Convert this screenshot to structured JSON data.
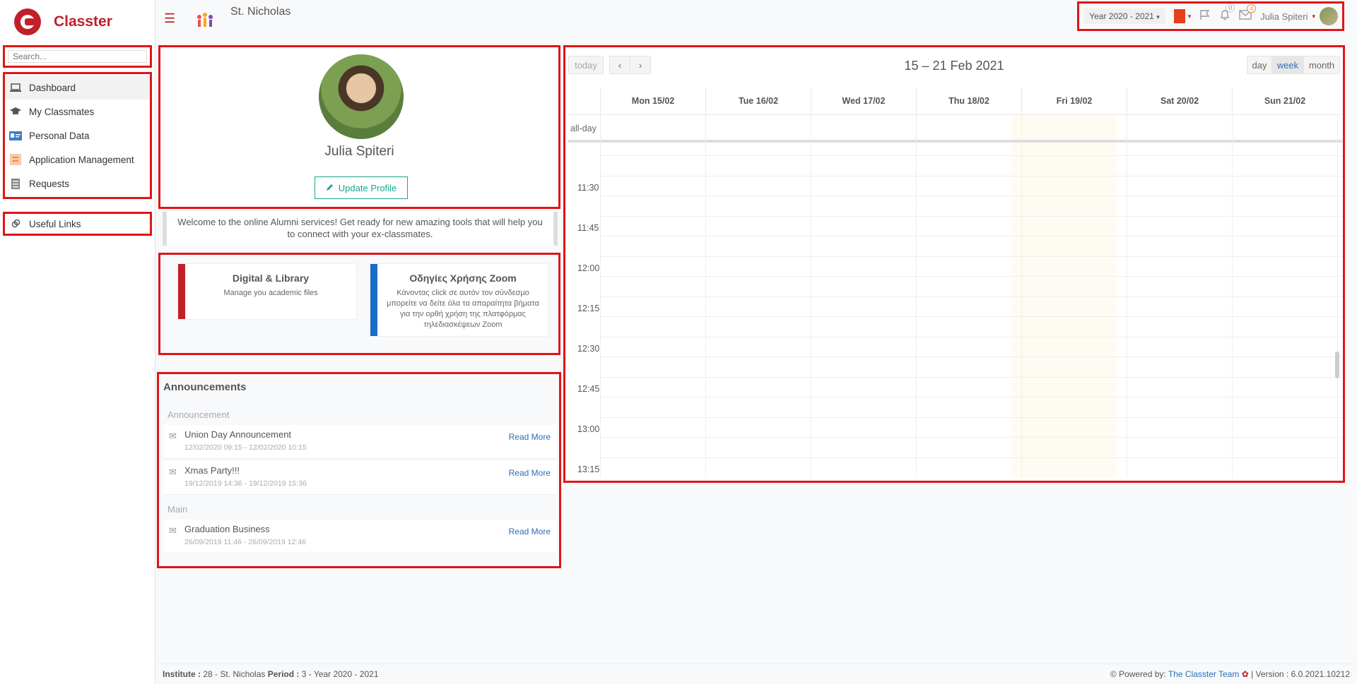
{
  "app": {
    "name": "Classter"
  },
  "sidebar": {
    "search_placeholder": "Search...",
    "items": [
      {
        "label": "Dashboard"
      },
      {
        "label": "My Classmates"
      },
      {
        "label": "Personal Data"
      },
      {
        "label": "Application Management"
      },
      {
        "label": "Requests"
      }
    ],
    "useful_links": "Useful Links"
  },
  "header": {
    "school_name": "St. Nicholas",
    "year": "Year 2020 - 2021",
    "notifications_count": "0",
    "messages_count": "4",
    "user_name": "Julia Spiteri"
  },
  "profile": {
    "name": "Julia Spiteri",
    "update_label": "Update Profile"
  },
  "welcome_text": "Welcome to the online Alumni services! Get ready for new amazing tools that will help you to connect with your ex-classmates.",
  "link_cards": [
    {
      "title": "Digital & Library",
      "desc": "Manage you academic files",
      "color": "#c0202a"
    },
    {
      "title": "Οδηγίες Χρήσης Zoom",
      "desc": "Κάνοντας click σε αυτόν τον σύνδεσμο μπορείτε να δείτε όλα τα απαραίτητα βήματα για την ορθή χρήση της πλατφόρμας τηλεδιασκέψεων Zoom",
      "color": "#1a6cc6"
    }
  ],
  "announcements": {
    "title": "Announcements",
    "groups": [
      {
        "name": "Announcement",
        "items": [
          {
            "title": "Union Day Announcement",
            "date": "12/02/2020 09:15 - 12/02/2020 10:15",
            "action": "Read More"
          },
          {
            "title": "Xmas Party!!!",
            "date": "19/12/2019 14:36 - 19/12/2019 15:36",
            "action": "Read More"
          }
        ]
      },
      {
        "name": "Main",
        "items": [
          {
            "title": "Graduation Business",
            "date": "26/09/2019 11:46 - 26/09/2019 12:46",
            "action": "Read More"
          }
        ]
      }
    ]
  },
  "calendar": {
    "title": "15 – 21 Feb 2021",
    "today": "today",
    "prev": "‹",
    "next": "›",
    "views": [
      "day",
      "week",
      "month"
    ],
    "active_view": "week",
    "days": [
      "Mon 15/02",
      "Tue 16/02",
      "Wed 17/02",
      "Thu 18/02",
      "Fri 19/02",
      "Sat 20/02",
      "Sun 21/02"
    ],
    "allday_label": "all-day",
    "times": [
      "11:30",
      "11:45",
      "12:00",
      "12:15",
      "12:30",
      "12:45",
      "13:00",
      "13:15"
    ]
  },
  "footer": {
    "institute_label": "Institute :",
    "institute_value": "28 - St. Nicholas",
    "period_label": "Period :",
    "period_value": "3 - Year 2020 - 2021",
    "powered_label": "Powered by:",
    "powered_link": "The Classter Team",
    "version": "| Version : 6.0.2021.10212"
  }
}
